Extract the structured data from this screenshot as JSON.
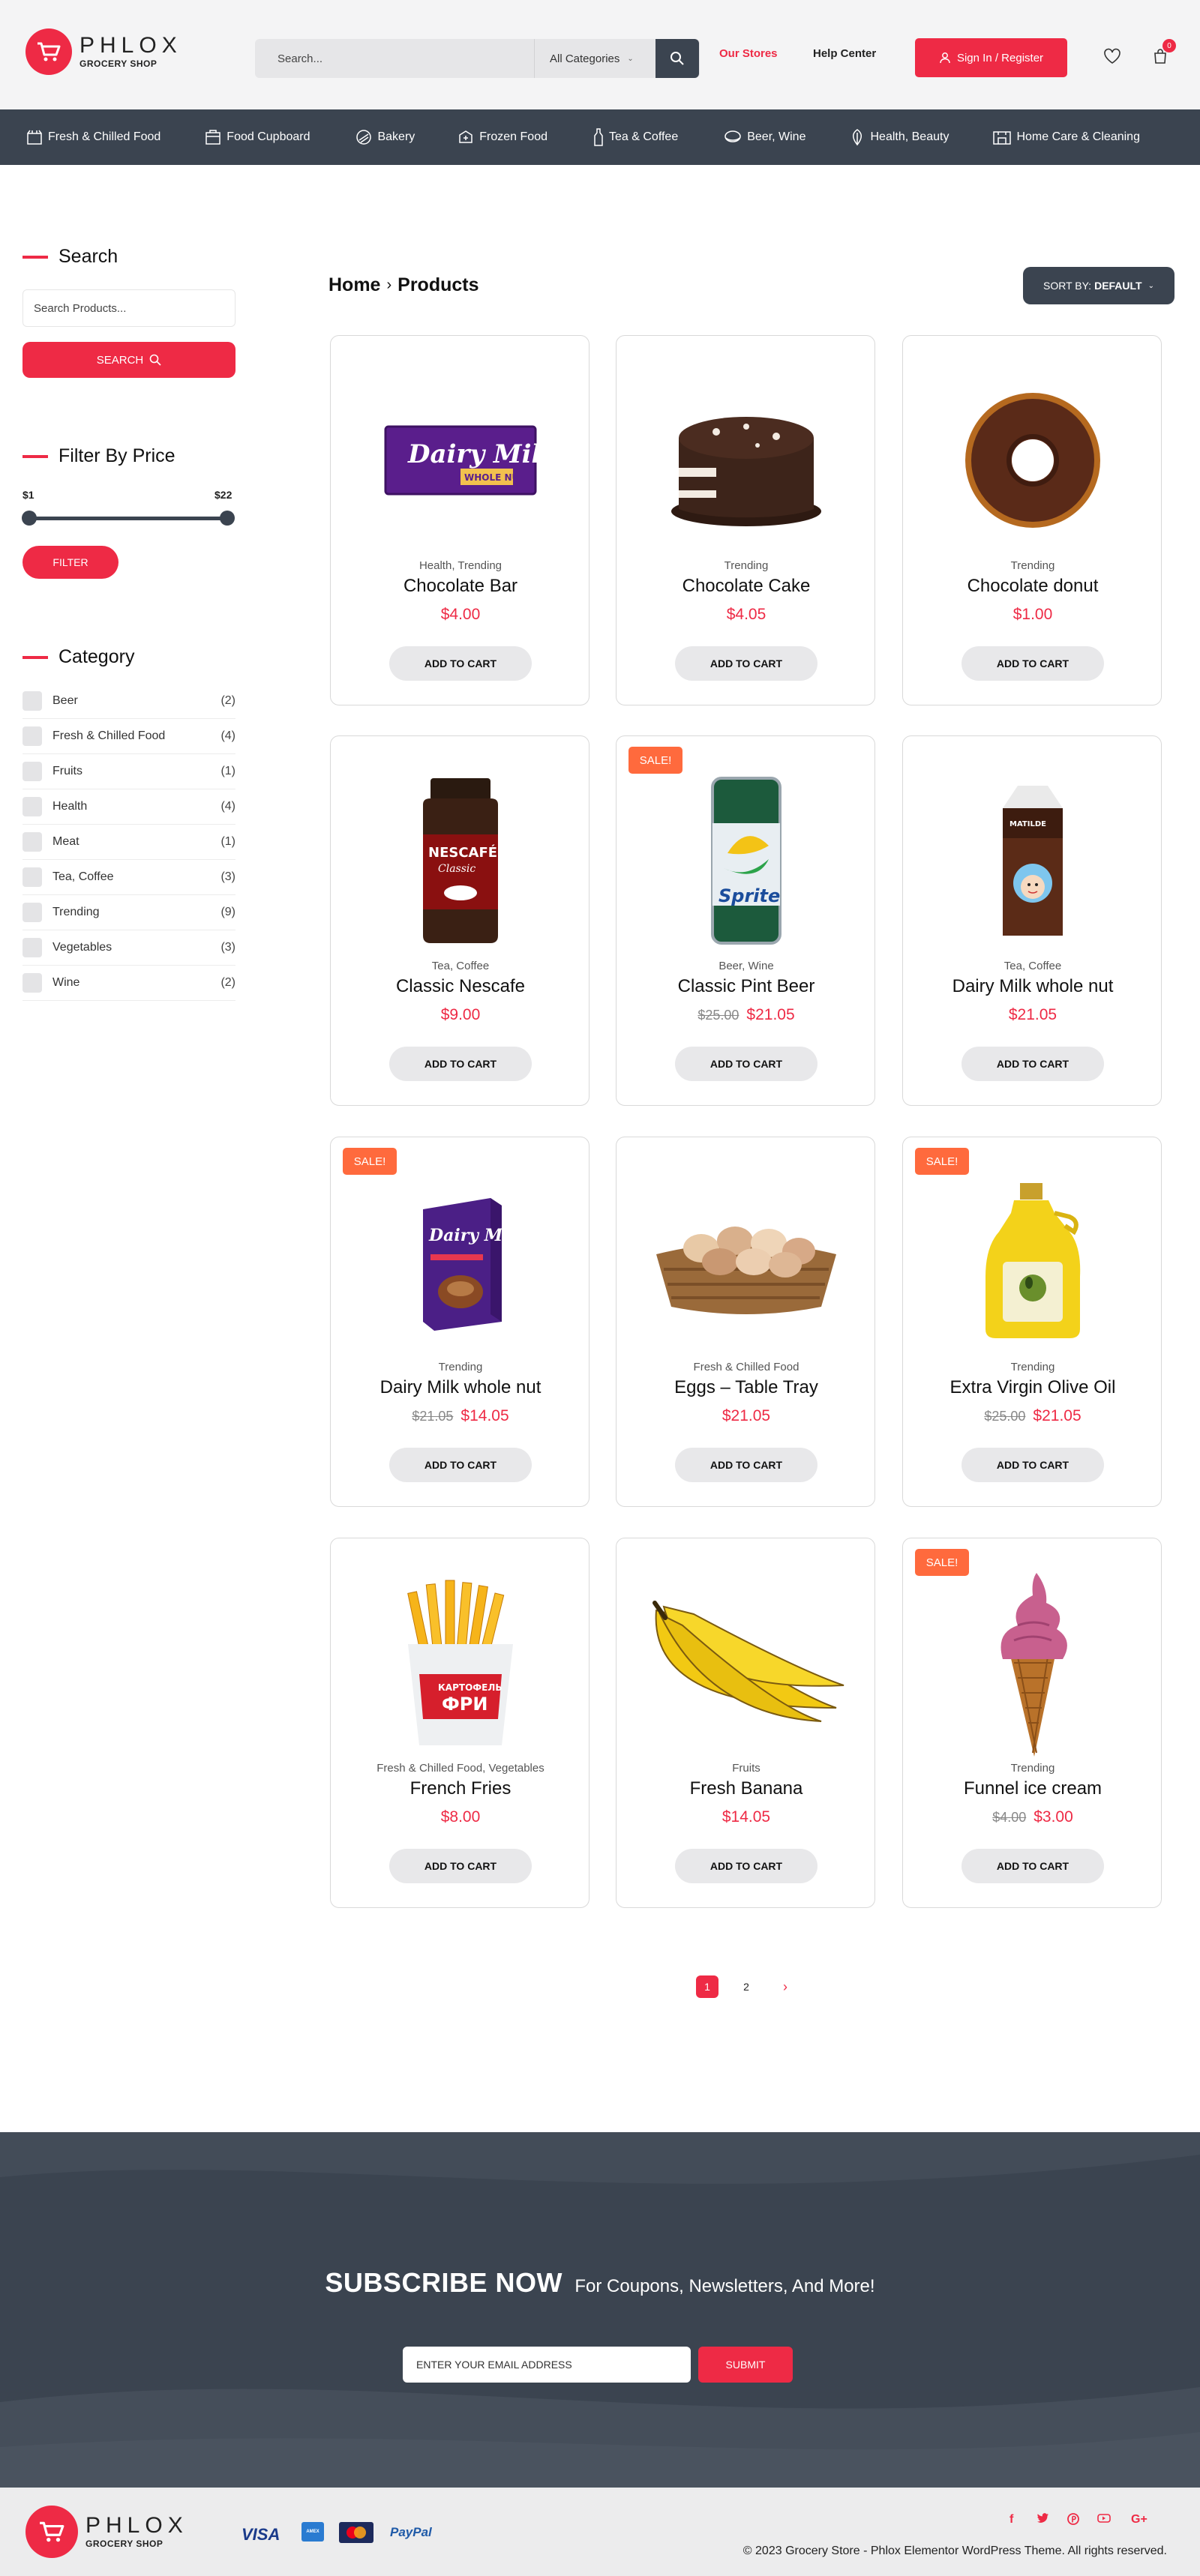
{
  "brand": {
    "name": "PHLOX",
    "subtitle": "GROCERY SHOP",
    "accent": "#ee2a45",
    "dark": "#3b4450"
  },
  "header": {
    "search_placeholder": "Search...",
    "category_select": "All Categories",
    "our_stores": "Our Stores",
    "help_center": "Help Center",
    "signin": "Sign In / Register",
    "cart_count": "0"
  },
  "nav": [
    {
      "label": "Fresh & Chilled Food",
      "icon": "fridge-icon"
    },
    {
      "label": "Food Cupboard",
      "icon": "cupboard-icon"
    },
    {
      "label": "Bakery",
      "icon": "bread-icon"
    },
    {
      "label": "Frozen Food",
      "icon": "frozen-icon"
    },
    {
      "label": "Tea & Coffee",
      "icon": "bottle-icon"
    },
    {
      "label": "Beer, Wine",
      "icon": "beer-icon"
    },
    {
      "label": "Health, Beauty",
      "icon": "leaf-icon"
    },
    {
      "label": "Home Care & Cleaning",
      "icon": "home-icon"
    }
  ],
  "sidebar": {
    "search_title": "Search",
    "search_placeholder": "Search Products...",
    "search_button": "SEARCH",
    "price_title": "Filter By Price",
    "price_min": "$1",
    "price_max": "$22",
    "filter_button": "FILTER",
    "category_title": "Category",
    "categories": [
      {
        "label": "Beer",
        "count": "(2)"
      },
      {
        "label": "Fresh & Chilled Food",
        "count": "(4)"
      },
      {
        "label": "Fruits",
        "count": "(1)"
      },
      {
        "label": "Health",
        "count": "(4)"
      },
      {
        "label": "Meat",
        "count": "(1)"
      },
      {
        "label": "Tea, Coffee",
        "count": "(3)"
      },
      {
        "label": "Trending",
        "count": "(9)"
      },
      {
        "label": "Vegetables",
        "count": "(3)"
      },
      {
        "label": "Wine",
        "count": "(2)"
      }
    ]
  },
  "main": {
    "breadcrumb_home": "Home",
    "breadcrumb_current": "Products",
    "sort_label": "SORT BY:",
    "sort_value": "DEFAULT",
    "add_to_cart": "ADD TO CART",
    "sale_label": "SALE!",
    "products": [
      {
        "name": "Chocolate Bar",
        "cats": "Health, Trending",
        "price": "$4.00",
        "old": "",
        "sale": false,
        "img": "chocolate-bar"
      },
      {
        "name": "Chocolate Cake",
        "cats": "Trending",
        "price": "$4.05",
        "old": "",
        "sale": false,
        "img": "chocolate-cake"
      },
      {
        "name": "Chocolate donut",
        "cats": "Trending",
        "price": "$1.00",
        "old": "",
        "sale": false,
        "img": "donut"
      },
      {
        "name": "Classic Nescafe",
        "cats": "Tea, Coffee",
        "price": "$9.00",
        "old": "",
        "sale": false,
        "img": "nescafe-jar"
      },
      {
        "name": "Classic Pint Beer",
        "cats": "Beer, Wine",
        "price": "$21.05",
        "old": "$25.00",
        "sale": true,
        "img": "sprite-can"
      },
      {
        "name": "Dairy Milk whole nut",
        "cats": "Tea, Coffee",
        "price": "$21.05",
        "old": "",
        "sale": false,
        "img": "milk-carton"
      },
      {
        "name": "Dairy Milk whole nut",
        "cats": "Trending",
        "price": "$14.05",
        "old": "$21.05",
        "sale": true,
        "img": "dairy-milk-box"
      },
      {
        "name": "Eggs – Table Tray",
        "cats": "Fresh & Chilled Food",
        "price": "$21.05",
        "old": "",
        "sale": false,
        "img": "egg-basket"
      },
      {
        "name": "Extra Virgin Olive Oil",
        "cats": "Trending",
        "price": "$21.05",
        "old": "$25.00",
        "sale": true,
        "img": "olive-oil"
      },
      {
        "name": "French Fries",
        "cats": "Fresh & Chilled Food, Vegetables",
        "price": "$8.00",
        "old": "",
        "sale": false,
        "img": "fries"
      },
      {
        "name": "Fresh Banana",
        "cats": "Fruits",
        "price": "$14.05",
        "old": "",
        "sale": false,
        "img": "banana"
      },
      {
        "name": "Funnel ice cream",
        "cats": "Trending",
        "price": "$3.00",
        "old": "$4.00",
        "sale": true,
        "img": "ice-cream"
      }
    ],
    "pagination": [
      "1",
      "2",
      "›"
    ]
  },
  "subscribe": {
    "title": "SUBSCRIBE NOW",
    "subtitle": "For Coupons, Newsletters, And More!",
    "placeholder": "ENTER YOUR EMAIL ADDRESS",
    "button": "SUBMIT"
  },
  "footer": {
    "payments": [
      "VISA",
      "AMEX",
      "MasterCard",
      "PayPal"
    ],
    "social": [
      "f",
      "t",
      "p",
      "yt",
      "G+"
    ],
    "copyright": "© 2023 Grocery Store - Phlox Elementor WordPress Theme. All rights reserved."
  }
}
